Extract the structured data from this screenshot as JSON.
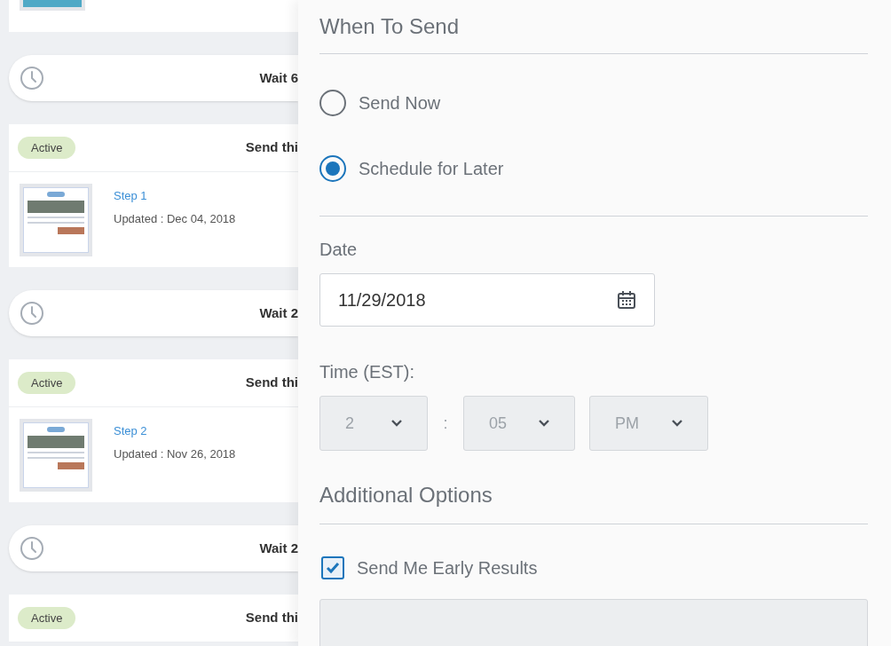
{
  "sequence": [
    {
      "kind": "thumb_tail"
    },
    {
      "kind": "wait",
      "label": "Wait 6"
    },
    {
      "kind": "email",
      "status": "Active",
      "title": "Send thi",
      "step": "Step 1",
      "updated": "Updated : Dec 04, 2018"
    },
    {
      "kind": "wait",
      "label": "Wait 2"
    },
    {
      "kind": "email",
      "status": "Active",
      "title": "Send thi",
      "step": "Step 2",
      "updated": "Updated : Nov 26, 2018"
    },
    {
      "kind": "wait",
      "label": "Wait 2"
    },
    {
      "kind": "email",
      "status": "Active",
      "title": "Send thi"
    }
  ],
  "panel": {
    "heading": "When To Send",
    "send_options": [
      {
        "label": "Send Now",
        "selected": false
      },
      {
        "label": "Schedule for Later",
        "selected": true
      }
    ],
    "date": {
      "label": "Date",
      "value": "11/29/2018"
    },
    "time": {
      "label": "Time (EST):",
      "hour": "2",
      "separator": ":",
      "minute": "05",
      "period": "PM"
    },
    "additional_heading": "Additional Options",
    "early_results": {
      "label": "Send Me Early Results",
      "checked": true
    }
  }
}
